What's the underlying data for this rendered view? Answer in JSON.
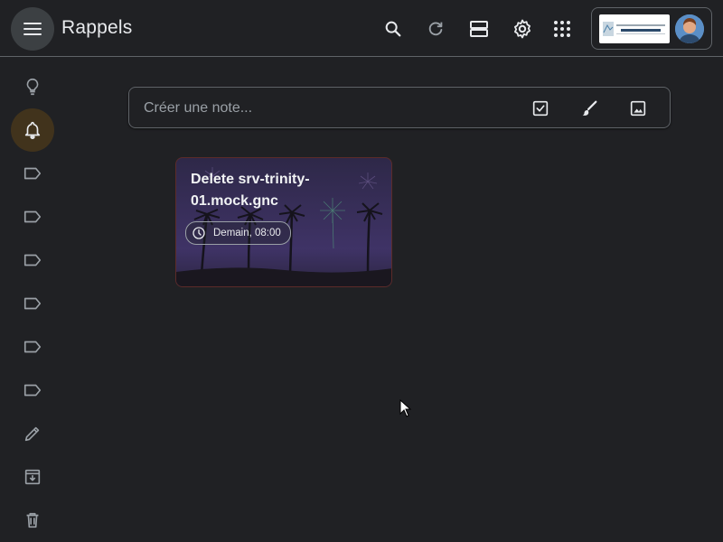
{
  "header": {
    "title": "Rappels",
    "icons": [
      "menu-icon",
      "search-icon",
      "refresh-icon",
      "list-view-icon",
      "settings-icon",
      "apps-icon"
    ],
    "account": {
      "logo_text": "NOUVELLE-CALÉDONIE",
      "logo_subtext": "GOUVERNEMENT DE LA"
    }
  },
  "sidebar": {
    "items": [
      {
        "name": "Notes",
        "icon": "lightbulb-icon",
        "active": false
      },
      {
        "name": "Rappels",
        "icon": "bell-icon",
        "active": true
      },
      {
        "name": "label-1",
        "icon": "label-icon"
      },
      {
        "name": "label-2",
        "icon": "label-icon"
      },
      {
        "name": "label-3",
        "icon": "label-icon"
      },
      {
        "name": "label-4",
        "icon": "label-icon"
      },
      {
        "name": "label-5",
        "icon": "label-icon"
      },
      {
        "name": "label-6",
        "icon": "label-icon"
      },
      {
        "name": "edit-labels",
        "icon": "pencil-icon"
      },
      {
        "name": "archive",
        "icon": "archive-icon"
      },
      {
        "name": "trash",
        "icon": "trash-icon"
      }
    ]
  },
  "composer": {
    "placeholder": "Créer une note...",
    "icons": [
      "checkbox-icon",
      "brush-icon",
      "image-icon"
    ]
  },
  "notes": [
    {
      "title": "Delete srv-trinity-01.mock.gnc",
      "reminder": "Demain, 08:00",
      "border_color": "#5c2b29"
    }
  ],
  "colors": {
    "background": "#202124",
    "active_sidebar": "#41331c",
    "divider": "#5f6368"
  }
}
